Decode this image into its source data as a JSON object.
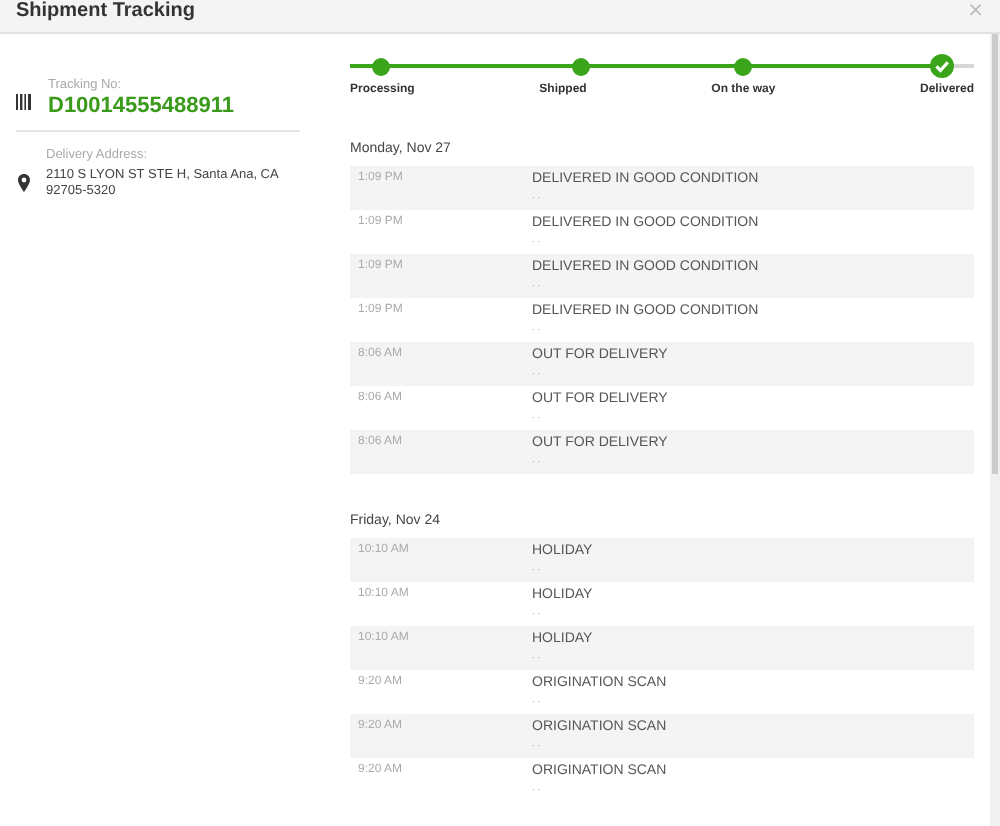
{
  "window": {
    "title": "Shipment Tracking",
    "close": "×"
  },
  "shipment": {
    "tracking_label": "Tracking No:",
    "tracking_number": "D10014555488911",
    "address_label": "Delivery Address:",
    "address": "2110 S LYON ST STE H, Santa Ana, CA 92705-5320"
  },
  "steps": [
    {
      "label": "Processing",
      "done": true,
      "kind": "dot"
    },
    {
      "label": "Shipped",
      "done": true,
      "kind": "dot"
    },
    {
      "label": "On the way",
      "done": true,
      "kind": "dot"
    },
    {
      "label": "Delivered",
      "done": true,
      "kind": "check"
    }
  ],
  "days": [
    {
      "date": "Monday, Nov 27",
      "events": [
        {
          "time": "1:09 PM",
          "status": "DELIVERED IN GOOD CONDITION",
          "location": ". ."
        },
        {
          "time": "1:09 PM",
          "status": "DELIVERED IN GOOD CONDITION",
          "location": ". ."
        },
        {
          "time": "1:09 PM",
          "status": "DELIVERED IN GOOD CONDITION",
          "location": ". ."
        },
        {
          "time": "1:09 PM",
          "status": "DELIVERED IN GOOD CONDITION",
          "location": ". ."
        },
        {
          "time": "8:06 AM",
          "status": "OUT FOR DELIVERY",
          "location": ". ."
        },
        {
          "time": "8:06 AM",
          "status": "OUT FOR DELIVERY",
          "location": ". ."
        },
        {
          "time": "8:06 AM",
          "status": "OUT FOR DELIVERY",
          "location": ". ."
        }
      ]
    },
    {
      "date": "Friday, Nov 24",
      "events": [
        {
          "time": "10:10 AM",
          "status": "HOLIDAY",
          "location": ". ."
        },
        {
          "time": "10:10 AM",
          "status": "HOLIDAY",
          "location": ". ."
        },
        {
          "time": "10:10 AM",
          "status": "HOLIDAY",
          "location": ". ."
        },
        {
          "time": "9:20 AM",
          "status": "ORIGINATION SCAN",
          "location": ". ."
        },
        {
          "time": "9:20 AM",
          "status": "ORIGINATION SCAN",
          "location": ". ."
        },
        {
          "time": "9:20 AM",
          "status": "ORIGINATION SCAN",
          "location": ". ."
        }
      ]
    }
  ]
}
